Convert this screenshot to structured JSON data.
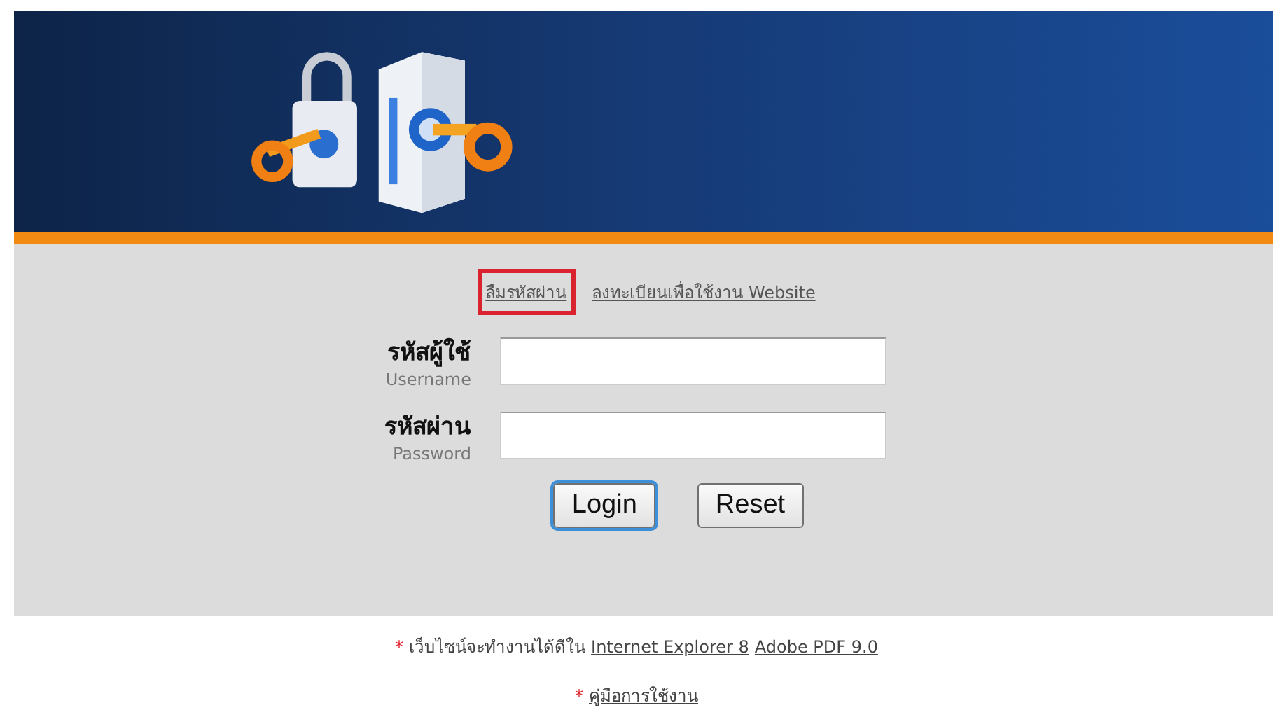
{
  "top_links": [
    {
      "label": "ลืมรหัสผ่าน",
      "highlighted": true
    },
    {
      "label": "ลงทะเบียนเพื่อใช้งาน Website",
      "highlighted": false
    }
  ],
  "fields": [
    {
      "label": "รหัสผู้ใช้",
      "sublabel": "Username"
    },
    {
      "label": "รหัสผ่าน",
      "sublabel": "Password"
    }
  ],
  "buttons": [
    "Login",
    "Reset"
  ],
  "notes": [
    {
      "mark": "*",
      "text": "เว็บไซน์จะทำงานได้ดีใน",
      "links": [
        "Internet Explorer 8",
        "Adobe PDF 9.0"
      ]
    },
    {
      "mark": "*",
      "links": [
        "คู่มือการใช้งาน"
      ]
    }
  ]
}
